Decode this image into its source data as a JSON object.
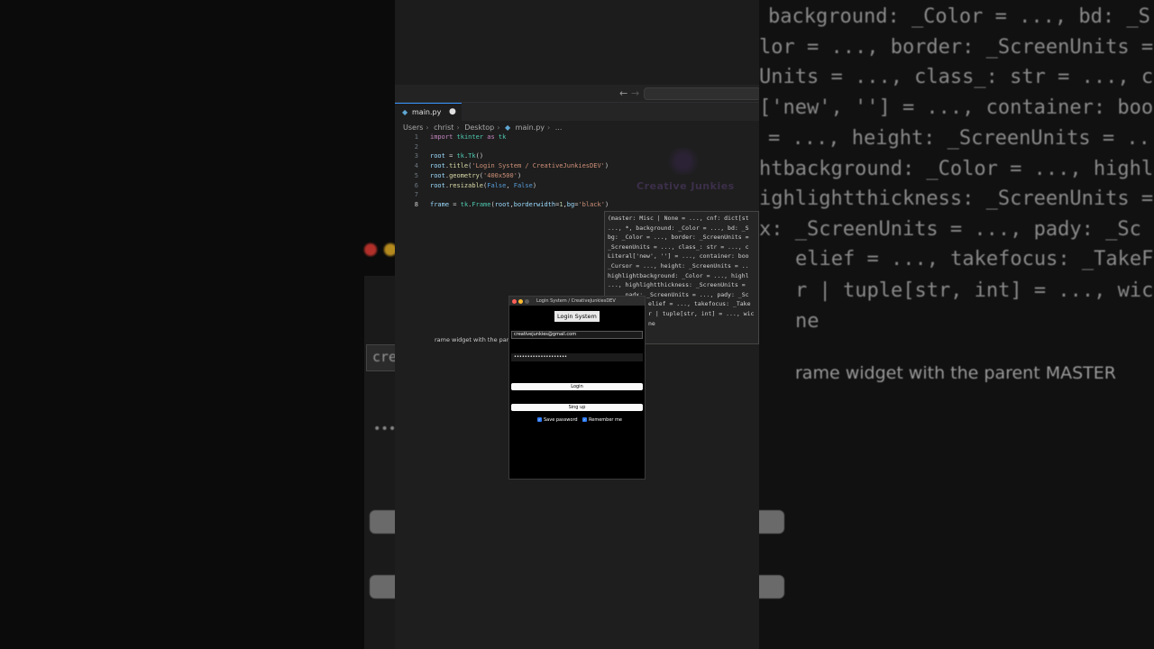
{
  "editor": {
    "tab_icon": "python-file-icon",
    "tab_label": "main.py",
    "tab_modified": "●",
    "breadcrumb": [
      "Users",
      "christ",
      "Desktop",
      "main.py",
      "..."
    ],
    "code_lines": [
      {
        "n": "1",
        "tokens": [
          {
            "t": "import ",
            "c": "kw"
          },
          {
            "t": "tkinter ",
            "c": "mod"
          },
          {
            "t": "as ",
            "c": "kw"
          },
          {
            "t": "tk",
            "c": "mod"
          }
        ]
      },
      {
        "n": "2",
        "tokens": []
      },
      {
        "n": "3",
        "tokens": [
          {
            "t": "root ",
            "c": "var"
          },
          {
            "t": "= ",
            "c": ""
          },
          {
            "t": "tk",
            "c": "mod"
          },
          {
            "t": ".",
            "c": ""
          },
          {
            "t": "Tk",
            "c": "mod"
          },
          {
            "t": "()",
            "c": ""
          }
        ]
      },
      {
        "n": "4",
        "tokens": [
          {
            "t": "root",
            "c": "var"
          },
          {
            "t": ".",
            "c": ""
          },
          {
            "t": "title",
            "c": "fn"
          },
          {
            "t": "(",
            "c": ""
          },
          {
            "t": "'Login System / CreativeJunkiesDEV'",
            "c": "str"
          },
          {
            "t": ")",
            "c": ""
          }
        ]
      },
      {
        "n": "5",
        "tokens": [
          {
            "t": "root",
            "c": "var"
          },
          {
            "t": ".",
            "c": ""
          },
          {
            "t": "geometry",
            "c": "fn"
          },
          {
            "t": "(",
            "c": ""
          },
          {
            "t": "'400x500'",
            "c": "str"
          },
          {
            "t": ")",
            "c": ""
          }
        ]
      },
      {
        "n": "6",
        "tokens": [
          {
            "t": "root",
            "c": "var"
          },
          {
            "t": ".",
            "c": ""
          },
          {
            "t": "resizable",
            "c": "fn"
          },
          {
            "t": "(",
            "c": ""
          },
          {
            "t": "False",
            "c": "bool"
          },
          {
            "t": ", ",
            "c": ""
          },
          {
            "t": "False",
            "c": "bool"
          },
          {
            "t": ")",
            "c": ""
          }
        ]
      },
      {
        "n": "7",
        "tokens": []
      },
      {
        "n": "8",
        "tokens": [
          {
            "t": "frame ",
            "c": "var"
          },
          {
            "t": "= ",
            "c": ""
          },
          {
            "t": "tk",
            "c": "mod"
          },
          {
            "t": ".",
            "c": ""
          },
          {
            "t": "Frame",
            "c": "mod"
          },
          {
            "t": "(",
            "c": ""
          },
          {
            "t": "root",
            "c": "var"
          },
          {
            "t": ",",
            "c": ""
          },
          {
            "t": "borderwidth",
            "c": "var"
          },
          {
            "t": "=",
            "c": ""
          },
          {
            "t": "1",
            "c": "num"
          },
          {
            "t": ",",
            "c": ""
          },
          {
            "t": "bg",
            "c": "var"
          },
          {
            "t": "=",
            "c": ""
          },
          {
            "t": "'black'",
            "c": "str"
          },
          {
            "t": ")",
            "c": ""
          }
        ]
      }
    ],
    "watermark": "Creative Junkies"
  },
  "tooltip": {
    "lines": [
      "(master: Misc | None = ..., cnf: dict[st",
      "..., *, background: _Color = ..., bd: _S",
      "bg: _Color = ..., border: _ScreenUnits =",
      "_ScreenUnits = ..., class_: str = ..., c",
      "Literal['new', ''] = ..., container: boo",
      "_Cursor = ..., height: _ScreenUnits = ..",
      "highlightbackground: _Color = ..., highl",
      "..., highlightthickness: _ScreenUnits =",
      "..., padx: _ScreenUnits = ..., pady: _Sc",
      "elief = ..., takefocus: _Take",
      "r | tuple[str, int] = ..., wic",
      "ne"
    ],
    "doc": "rame widget with the parent MASTER"
  },
  "tk_window": {
    "title": "Login System / CreativeJunkiesDEV",
    "heading": "Login System",
    "email_value": "creativejunkies@gmail.com",
    "password_value": "••••••••••••••••••••",
    "login_label": "Login",
    "signup_label": "Sing up",
    "save_password_label": "Save password",
    "remember_me_label": "Remember me"
  },
  "background_right": {
    "lines": [
      "background: _Color = ..., bd: _S",
      "lor = ..., border: _ScreenUnits =",
      "Units = ..., class_: str = ..., c",
      "['new', ''] = ..., container: boo",
      "= ..., height: _ScreenUnits = ..",
      "htbackground: _Color = ..., highl",
      "ighlightthickness: _ScreenUnits =",
      "x: _ScreenUnits = ..., pady: _Sc",
      "elief = ..., takefocus: _TakeF",
      "r | tuple[str, int] = ..., wic",
      "ne",
      "rame widget with the parent MASTER"
    ]
  },
  "background_left": {
    "field_text": "cre",
    "password_text": "•••"
  }
}
